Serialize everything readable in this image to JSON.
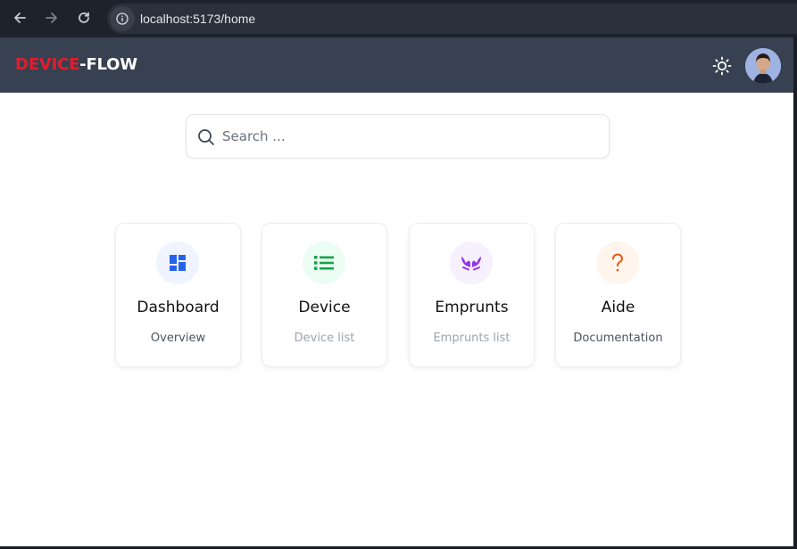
{
  "browser": {
    "url": "localhost:5173/home",
    "back_icon": "arrow-left-icon",
    "forward_icon": "arrow-right-icon",
    "reload_icon": "reload-icon",
    "info_icon": "info-icon"
  },
  "navbar": {
    "brand_part1": "DEVICE",
    "brand_part2": "-FLOW",
    "brand_color_primary": "#e11d2e",
    "background": "#374151",
    "theme_icon": "sun-icon",
    "avatar_icon": "user-avatar"
  },
  "search": {
    "placeholder": "Search ...",
    "value": "",
    "icon": "search-icon"
  },
  "cards": [
    {
      "title": "Dashboard",
      "subtitle": "Overview",
      "icon": "dashboard-icon",
      "icon_color": "#2563eb",
      "icon_bg": "#eff4ff",
      "subtitle_color": "#4b5563"
    },
    {
      "title": "Device",
      "subtitle": "Device list",
      "icon": "list-icon",
      "icon_color": "#16a34a",
      "icon_bg": "#ecfdf3",
      "subtitle_color": "#9ca3af"
    },
    {
      "title": "Emprunts",
      "subtitle": "Emprunts list",
      "icon": "hands-icon",
      "icon_color": "#9333ea",
      "icon_bg": "#f7f0fe",
      "subtitle_color": "#9ca3af"
    },
    {
      "title": "Aide",
      "subtitle": "Documentation",
      "icon": "question-icon",
      "icon_color": "#ea580c",
      "icon_bg": "#fff5ec",
      "subtitle_color": "#4b5563"
    }
  ]
}
